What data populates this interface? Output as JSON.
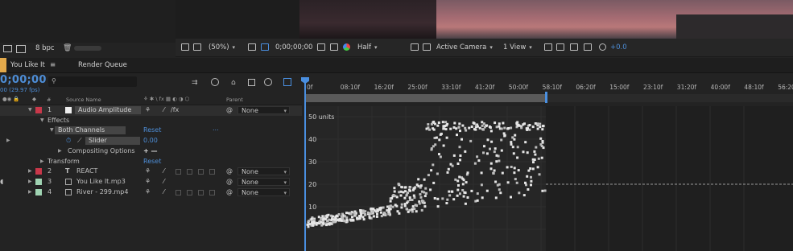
{
  "viewer_toolbar": {
    "bit_depth": "8 bpc",
    "zoom": "(50%)",
    "timecode": "0;00;00;00",
    "resolution": "Half",
    "camera": "Active Camera",
    "views": "1 View",
    "exposure": "+0.0"
  },
  "tabs": [
    {
      "label": "You Like It"
    },
    {
      "label": "Render Queue"
    }
  ],
  "timeline": {
    "current_time": "0;00;00",
    "fps": "00 (29.97 fps)",
    "search_placeholder": "",
    "column_headers": {
      "num": "#",
      "source_name": "Source Name",
      "parent": "Parent"
    },
    "ruler": [
      "0f",
      "08:10f",
      "16:20f",
      "25:00f",
      "33:10f",
      "41:20f",
      "50:00f",
      "58:10f",
      "06:20f",
      "15:00f",
      "23:10f",
      "31:20f",
      "40:00f",
      "48:10f",
      "56:20"
    ],
    "graph_axis": {
      "unit_label": "50 units",
      "ticks": [
        "40",
        "30",
        "20",
        "10"
      ]
    }
  },
  "layers": [
    {
      "num": "1",
      "name": "Audio Amplitude",
      "color": "#c8384a",
      "parent": "None",
      "type": "solid"
    },
    {
      "num": "2",
      "name": "REACT",
      "color": "#c8384a",
      "parent": "None",
      "type": "T"
    },
    {
      "num": "3",
      "name": "You Like It.mp3",
      "color": "#9fd3b2",
      "parent": "None",
      "type": "audio"
    },
    {
      "num": "4",
      "name": "River - 299.mp4",
      "color": "#9fd3b2",
      "parent": "None",
      "type": "video"
    }
  ],
  "properties": {
    "effects": "Effects",
    "both_channels": "Both Channels",
    "reset": "Reset",
    "ellipsis": "...",
    "slider": "Slider",
    "slider_value": "0.00",
    "compositing_options": "Compositing Options",
    "plus_minus": "+ —",
    "transform": "Transform",
    "transform_reset": "Reset"
  }
}
